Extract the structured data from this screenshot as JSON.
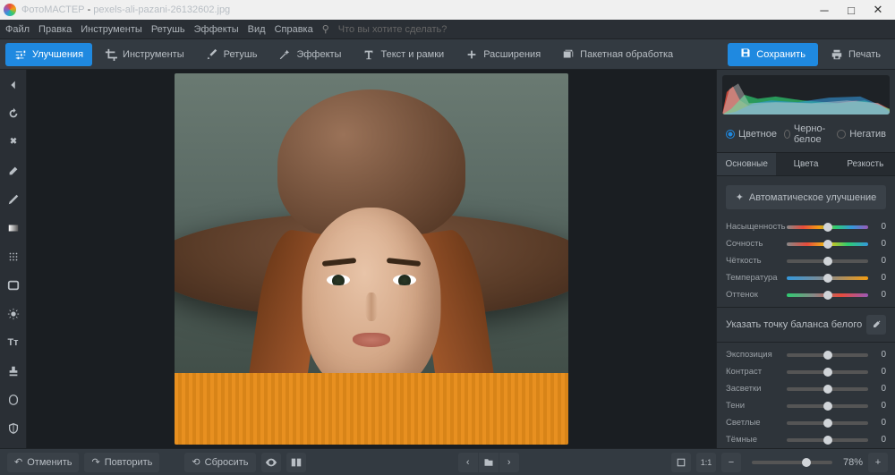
{
  "titlebar": {
    "app": "ФотоМАСТЕР",
    "file": "pexels-ali-pazani-26132602.jpg"
  },
  "menubar": {
    "items": [
      "Файл",
      "Правка",
      "Инструменты",
      "Ретушь",
      "Эффекты",
      "Вид",
      "Справка"
    ],
    "hint": "Что вы хотите сделать?"
  },
  "toolbar": {
    "items": [
      {
        "label": "Улучшения",
        "active": true
      },
      {
        "label": "Инструменты"
      },
      {
        "label": "Ретушь"
      },
      {
        "label": "Эффекты"
      },
      {
        "label": "Текст и рамки"
      },
      {
        "label": "Расширения"
      },
      {
        "label": "Пакетная обработка"
      }
    ],
    "save": "Сохранить",
    "print": "Печать"
  },
  "right": {
    "modes": [
      {
        "label": "Цветное",
        "on": true
      },
      {
        "label": "Черно-белое"
      },
      {
        "label": "Негатив"
      }
    ],
    "tabs": [
      {
        "label": "Основные",
        "active": true
      },
      {
        "label": "Цвета"
      },
      {
        "label": "Резкость"
      }
    ],
    "auto": "Автоматическое улучшение",
    "sliders1": [
      {
        "label": "Насыщенность",
        "val": "0",
        "grad": "grad-sat"
      },
      {
        "label": "Сочность",
        "val": "0",
        "grad": "grad-vib"
      },
      {
        "label": "Чёткость",
        "val": "0",
        "grad": "grad-gray"
      },
      {
        "label": "Температура",
        "val": "0",
        "grad": "grad-temp"
      },
      {
        "label": "Оттенок",
        "val": "0",
        "grad": "grad-tint"
      }
    ],
    "wb": "Указать точку баланса белого",
    "sliders2": [
      {
        "label": "Экспозиция",
        "val": "0"
      },
      {
        "label": "Контраст",
        "val": "0"
      },
      {
        "label": "Засветки",
        "val": "0"
      },
      {
        "label": "Тени",
        "val": "0"
      },
      {
        "label": "Светлые",
        "val": "0"
      },
      {
        "label": "Тёмные",
        "val": "0"
      }
    ]
  },
  "bottom": {
    "undo": "Отменить",
    "redo": "Повторить",
    "reset": "Сбросить",
    "ratio": "1:1",
    "zoom": "78%"
  }
}
